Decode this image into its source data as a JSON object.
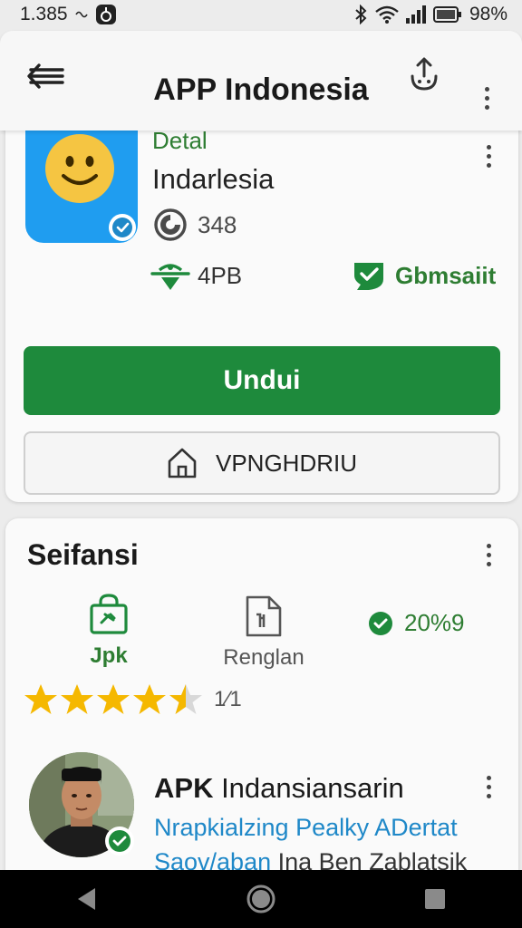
{
  "status_bar": {
    "time": "1.385",
    "battery": "98%"
  },
  "app_bar": {
    "title": "APP Indonesia"
  },
  "app": {
    "detail_label": "Detal",
    "name": "Indarlesia",
    "downloads": "348",
    "size": "4PB",
    "safe_label": "Gbmsaiit",
    "download_button": "Undui",
    "secondary_button": "VPNGHDRIU"
  },
  "info_section": {
    "title": "Seifansi",
    "item1_label": "Jpk",
    "item2_label": "Renglan",
    "percent": "20%9",
    "rating": 4.5,
    "rating_text": "1⁄1"
  },
  "developer": {
    "name_bold": "APK",
    "name_rest": " Indansiansarin",
    "line1": "Nrapkialzing Pealky ADertat",
    "line2_a": "Saov/aban",
    "line2_b": " Ina Ben Zablatsik"
  },
  "colors": {
    "primary_green": "#1e8a3c",
    "accent_blue": "#1f9df0",
    "link_blue": "#1f88c8",
    "star": "#f5b800"
  },
  "icons": {
    "back": "menu-back-icon",
    "share": "share-icon",
    "more": "more-vert-icon",
    "downloads": "download-count-icon",
    "size": "size-icon",
    "safe": "shield-check-icon",
    "home": "home-icon",
    "verified": "verified-check-icon"
  }
}
